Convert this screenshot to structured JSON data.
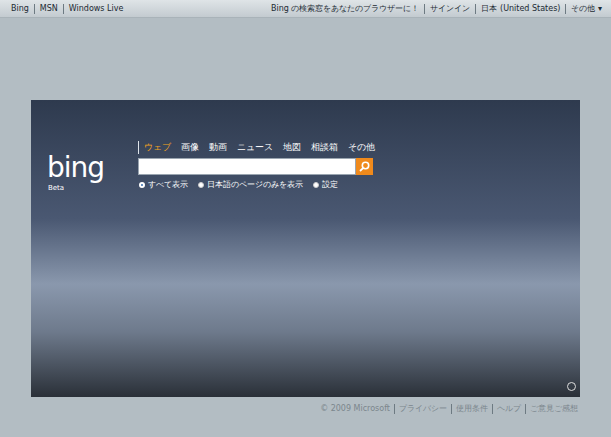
{
  "top_bar": {
    "left_links": [
      "Bing",
      "MSN",
      "Windows Live"
    ],
    "right_links": [
      "Bing の検索窓をあなたのブラウザーに！",
      "サインイン",
      "日本 (United States)"
    ],
    "more": {
      "label": "その他",
      "arrow": "▾"
    }
  },
  "logo": {
    "text": "bing",
    "badge": "Beta"
  },
  "nav_tabs": [
    {
      "label": "ウェブ",
      "selected": true
    },
    {
      "label": "画像",
      "selected": false
    },
    {
      "label": "動画",
      "selected": false
    },
    {
      "label": "ニュース",
      "selected": false
    },
    {
      "label": "地図",
      "selected": false
    },
    {
      "label": "相談箱",
      "selected": false
    },
    {
      "label": "その他",
      "selected": false
    }
  ],
  "scope_options": [
    {
      "label": "すべて表示",
      "selected": true
    },
    {
      "label": "日本語のページのみを表示",
      "selected": false
    }
  ],
  "settings": "設定",
  "footer": {
    "copyright": "© 2009 Microsoft",
    "links": [
      "プライバシー",
      "使用条件",
      "ヘルプ",
      "ご意見ご感想"
    ]
  }
}
